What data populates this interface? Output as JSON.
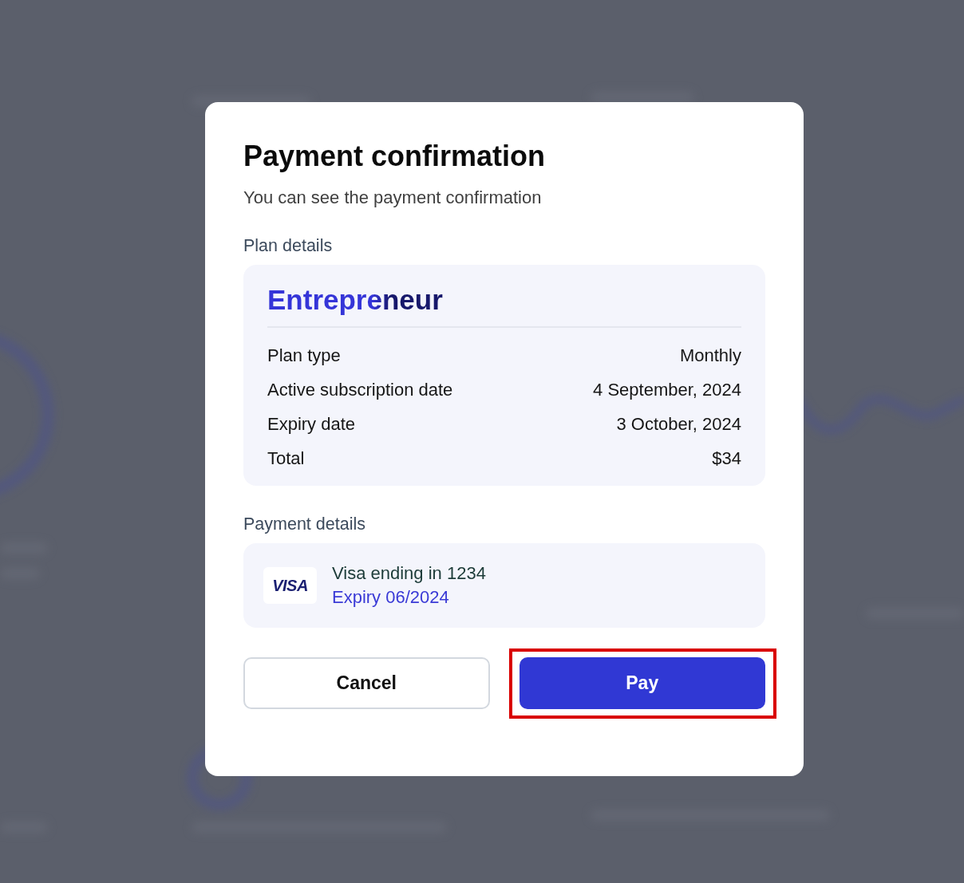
{
  "dialog": {
    "title": "Payment confirmation",
    "subtitle": "You can see the payment confirmation",
    "plan_section": {
      "label": "Plan details",
      "plan_name": "Entrepreneur",
      "rows": [
        {
          "label": "Plan type",
          "value": "Monthly"
        },
        {
          "label": "Active subscription date",
          "value": "4 September, 2024"
        },
        {
          "label": "Expiry date",
          "value": "3 October, 2024"
        },
        {
          "label": "Total",
          "value": "$34"
        }
      ]
    },
    "payment_section": {
      "label": "Payment details",
      "card": {
        "brand_logo": "VISA",
        "description": "Visa ending in 1234",
        "expiry": "Expiry 06/2024"
      }
    },
    "buttons": [
      {
        "label": "Cancel",
        "kind": "secondary",
        "highlighted": false
      },
      {
        "label": "Pay",
        "kind": "primary",
        "highlighted": true
      }
    ]
  }
}
